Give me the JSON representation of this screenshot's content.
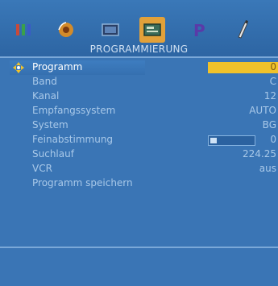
{
  "menu": {
    "title": "PROGRAMMIERUNG",
    "icons": [
      {
        "name": "picture-icon",
        "active": false
      },
      {
        "name": "sound-icon",
        "active": false
      },
      {
        "name": "screen-icon",
        "active": false
      },
      {
        "name": "programming-icon",
        "active": true
      },
      {
        "name": "p-icon",
        "active": false
      },
      {
        "name": "settings-icon",
        "active": false
      }
    ],
    "colors": {
      "background": "#2f6aa8",
      "panel": "#3a75b5",
      "highlight": "#f0c22a",
      "active_icon": "#e2a13a",
      "label_text": "#a9c9e9"
    },
    "items": [
      {
        "label": "Programm",
        "value": "0"
      },
      {
        "label": "Band",
        "value": "C"
      },
      {
        "label": "Kanal",
        "value": "12"
      },
      {
        "label": "Empfangssystem",
        "value": "AUTO"
      },
      {
        "label": "System",
        "value": "BG"
      },
      {
        "label": "Feinabstimmung",
        "value": "0",
        "slider_level": 0.15
      },
      {
        "label": "Suchlauf",
        "value": "224.25"
      },
      {
        "label": "VCR",
        "value": "aus"
      },
      {
        "label": "Programm speichern",
        "value": ""
      }
    ]
  }
}
